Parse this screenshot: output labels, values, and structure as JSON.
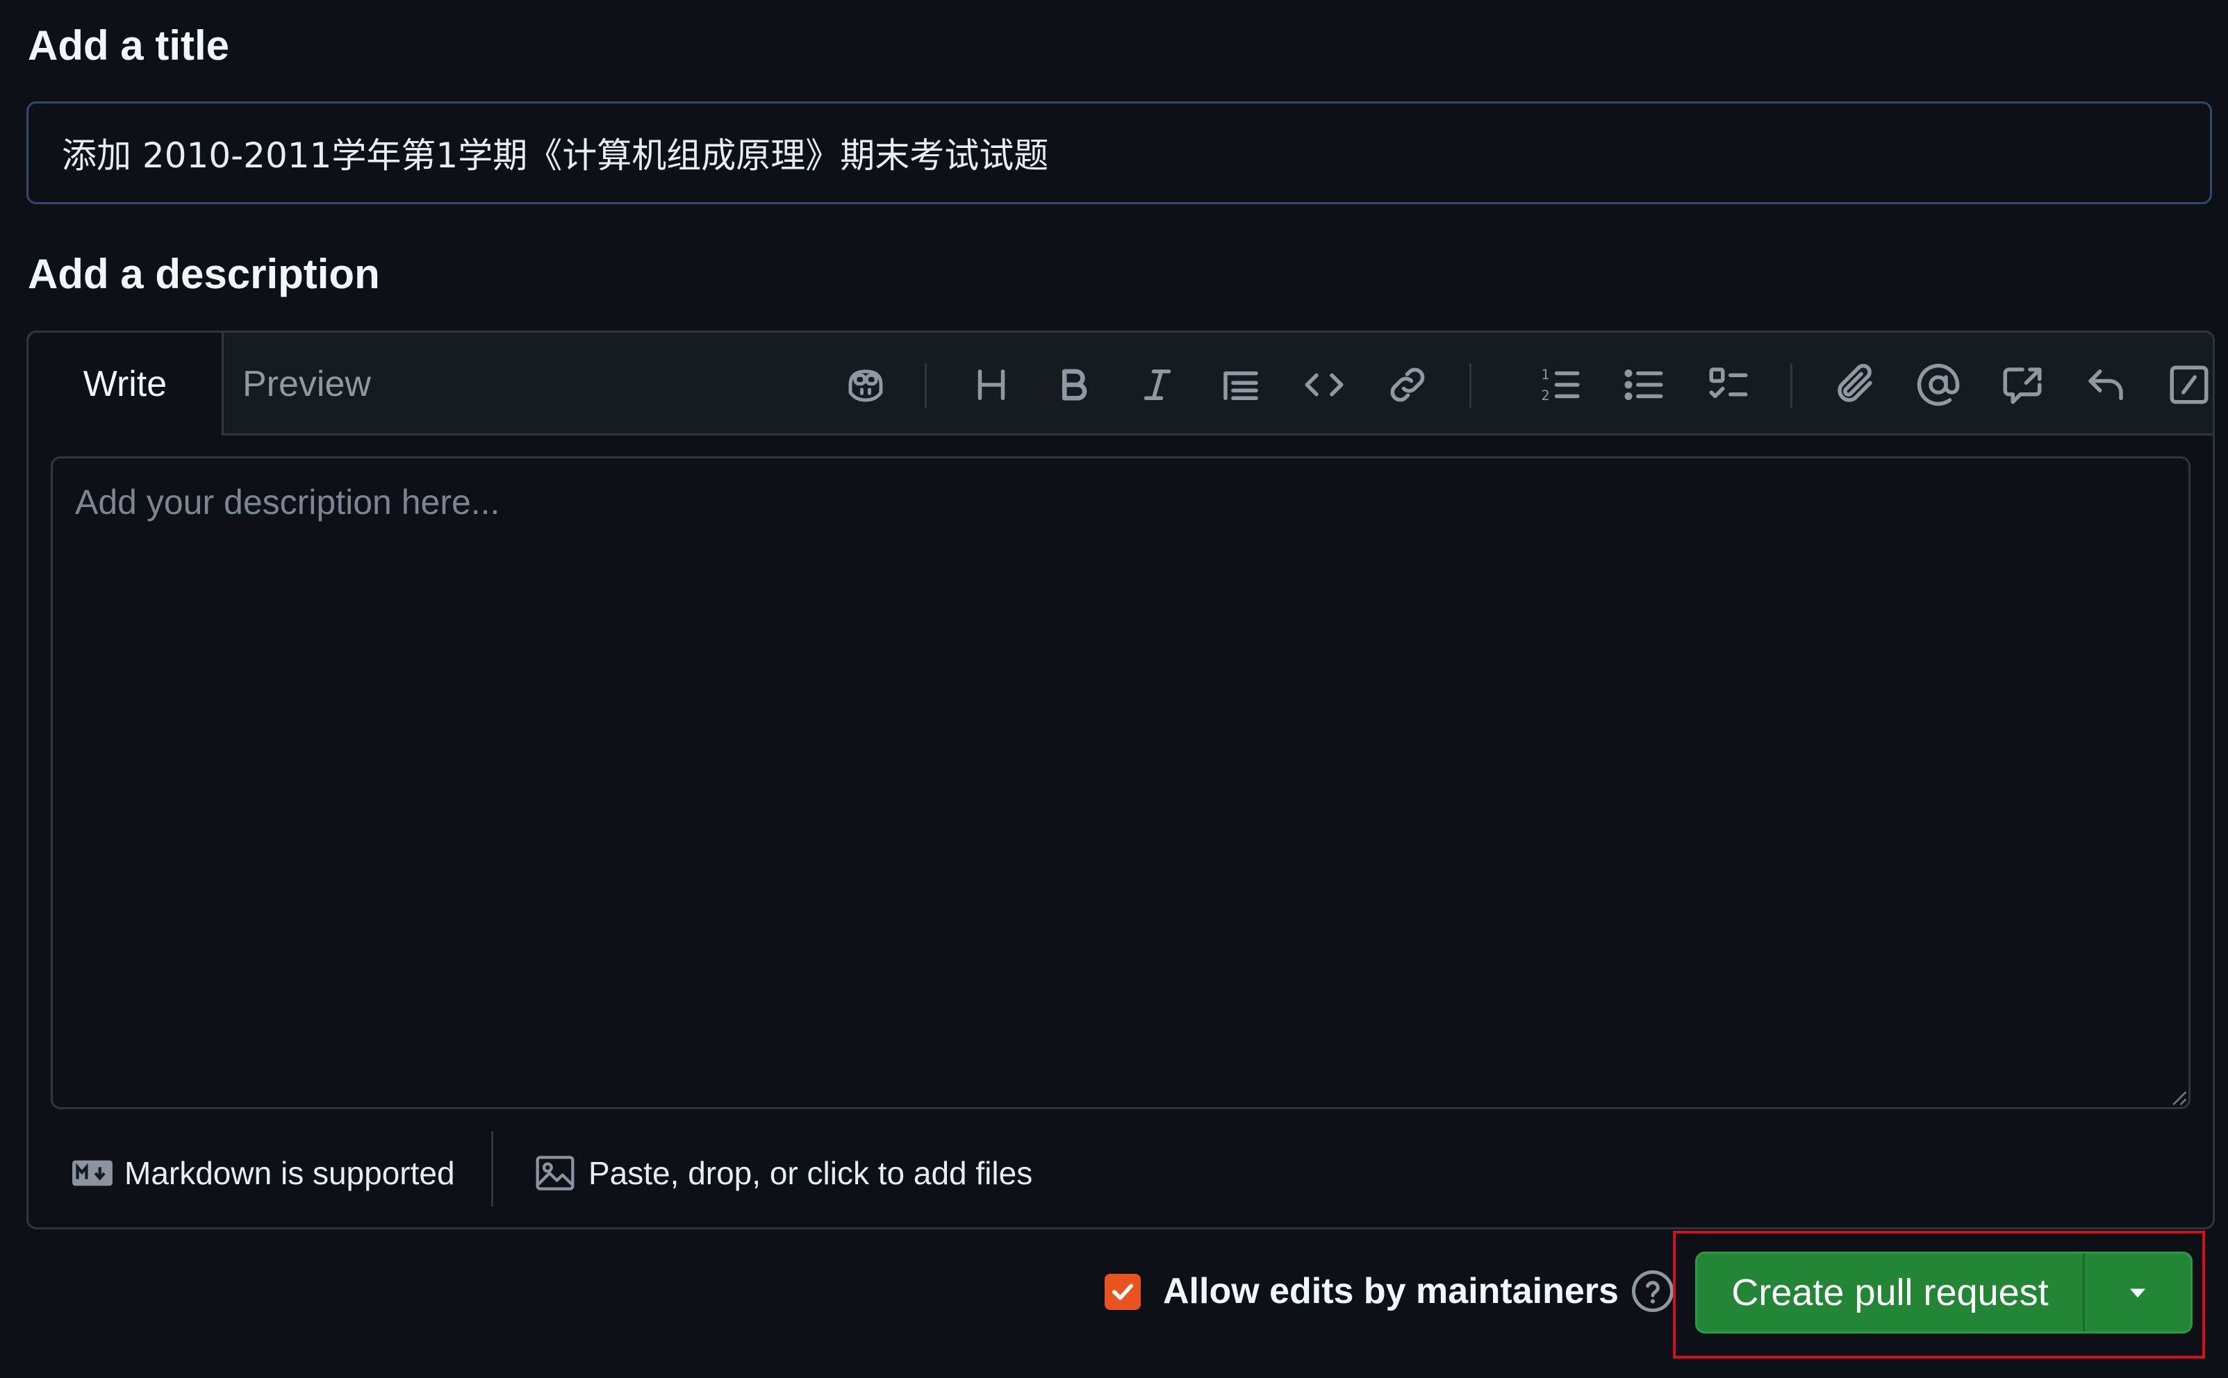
{
  "title_section": {
    "label": "Add a title",
    "value": "添加 2010-2011学年第1学期《计算机组成原理》期末考试试题"
  },
  "description_section": {
    "label": "Add a description",
    "tabs": [
      {
        "label": "Write",
        "active": true
      },
      {
        "label": "Preview",
        "active": false
      }
    ],
    "placeholder": "Add your description here...",
    "toolbar_icons": [
      "copilot-icon",
      "heading-icon",
      "bold-icon",
      "italic-icon",
      "quote-icon",
      "code-icon",
      "link-icon",
      "ordered-list-icon",
      "unordered-list-icon",
      "task-list-icon",
      "attach-icon",
      "mention-icon",
      "cross-reference-icon",
      "saved-reply-icon",
      "slash-command-icon"
    ],
    "footer": {
      "markdown_text": "Markdown is supported",
      "files_text": "Paste, drop, or click to add files"
    }
  },
  "actions": {
    "allow_edits_label": "Allow edits by maintainers",
    "allow_edits_checked": true,
    "create_button_label": "Create pull request"
  },
  "colors": {
    "background": "#0d1117",
    "panel": "#161b22",
    "border": "#30363d",
    "primary_button": "#238636",
    "checkbox": "#e8531f",
    "highlight": "#d3101d"
  }
}
